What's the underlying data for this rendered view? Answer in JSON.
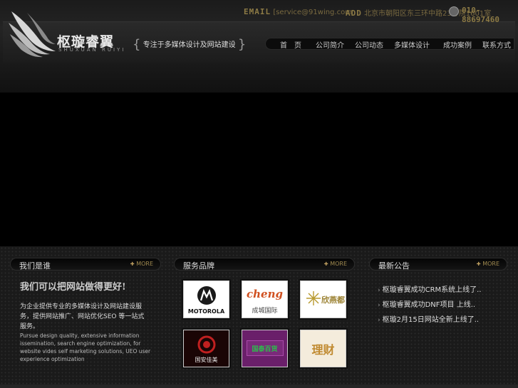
{
  "header": {
    "logo_cn": "枢璇睿翼",
    "logo_en": "SHUXUAN RUIYI",
    "slogan": "专注于多媒体设计及网站建设",
    "email_label": "EMAIL",
    "email_value": "[service@91wing.com",
    "address_label": "ADD",
    "address_value": "北京市朝阳区东三环中路23号院1601室",
    "phone": "010-88697460"
  },
  "nav": [
    "首　页",
    "公司简介",
    "公司动态",
    "多媒体设计",
    "成功案例",
    "联系方式"
  ],
  "panels": {
    "about": {
      "title": "我们是谁",
      "more": "MORE",
      "headline": "我们可以把网站做得更好!",
      "body": "为企业提供专业的多媒体设计及网站建设服务，提供网站推广、网站优化SEO 等一站式服务。",
      "english": "Pursue design quality, extensive information issemination, search engine optimization, for website vides self marketing solutions, UEO user experience optimization"
    },
    "brands": {
      "title": "服务品牌",
      "more": "MORE",
      "items": [
        {
          "name": "MOTOROLA"
        },
        {
          "name": "cheng",
          "sub": "成城国际"
        },
        {
          "name": "欣燕都"
        },
        {
          "name": "国安佳美"
        },
        {
          "name": "国泰百货"
        },
        {
          "name": "理财"
        }
      ]
    },
    "news": {
      "title": "最新公告",
      "more": "MORE",
      "items": [
        "枢璇睿翼成功CRM系统上线了..",
        "枢璇睿翼成功DNF项目 上线..",
        "枢璇2月15日网站全新上线了.."
      ]
    }
  },
  "colors": {
    "background": "#000000",
    "accent_gold": "#8c7a45",
    "panel_bg": "#1a1a1a"
  }
}
